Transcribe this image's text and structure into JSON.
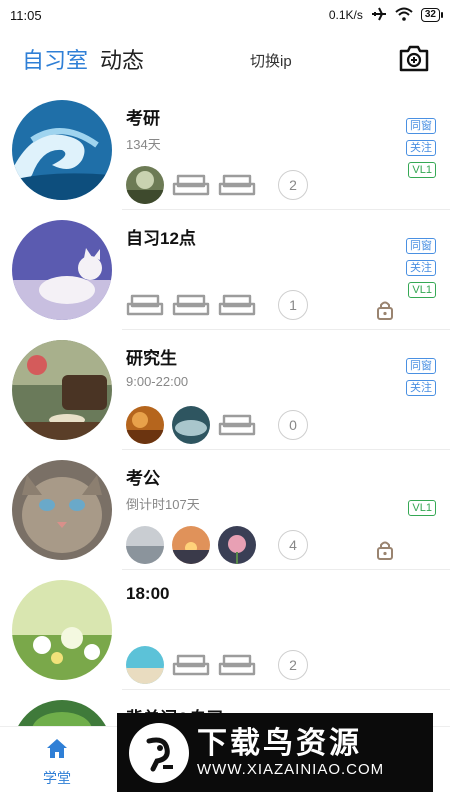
{
  "status_bar": {
    "time": "11:05",
    "net_speed": "0.1K/s",
    "battery": "32"
  },
  "header": {
    "tab_active": "自习室",
    "tab_inactive": "动态",
    "switch_label": "切换ip",
    "camera_icon": "camera-icon"
  },
  "colors": {
    "accent": "#2f7fd6",
    "tag_blue": "#4a90e2",
    "tag_green": "#35a854"
  },
  "rooms": [
    {
      "name": "考研",
      "sub": "134天",
      "count": "2",
      "tags": [
        "同窗",
        "关注",
        "VL1"
      ],
      "locked": false
    },
    {
      "name": "自习12点",
      "sub": "",
      "count": "1",
      "tags": [
        "同窗",
        "关注",
        "VL1"
      ],
      "locked": true
    },
    {
      "name": "研究生",
      "sub": "9:00-22:00",
      "count": "0",
      "tags": [
        "同窗",
        "关注"
      ],
      "locked": false
    },
    {
      "name": "考公",
      "sub": "倒计时107天",
      "count": "4",
      "tags": [
        "VL1"
      ],
      "locked": true
    },
    {
      "name": "18:00",
      "sub": "",
      "count": "2",
      "tags": [],
      "locked": false
    },
    {
      "name": "背单词&自习",
      "sub": "",
      "count": "",
      "tags": [],
      "locked": false
    }
  ],
  "bottom_nav": {
    "home_label": "学堂",
    "home_icon": "home-icon"
  },
  "banner": {
    "title": "下载鸟资源",
    "url": "WWW.XIAZAINIAO.COM"
  }
}
